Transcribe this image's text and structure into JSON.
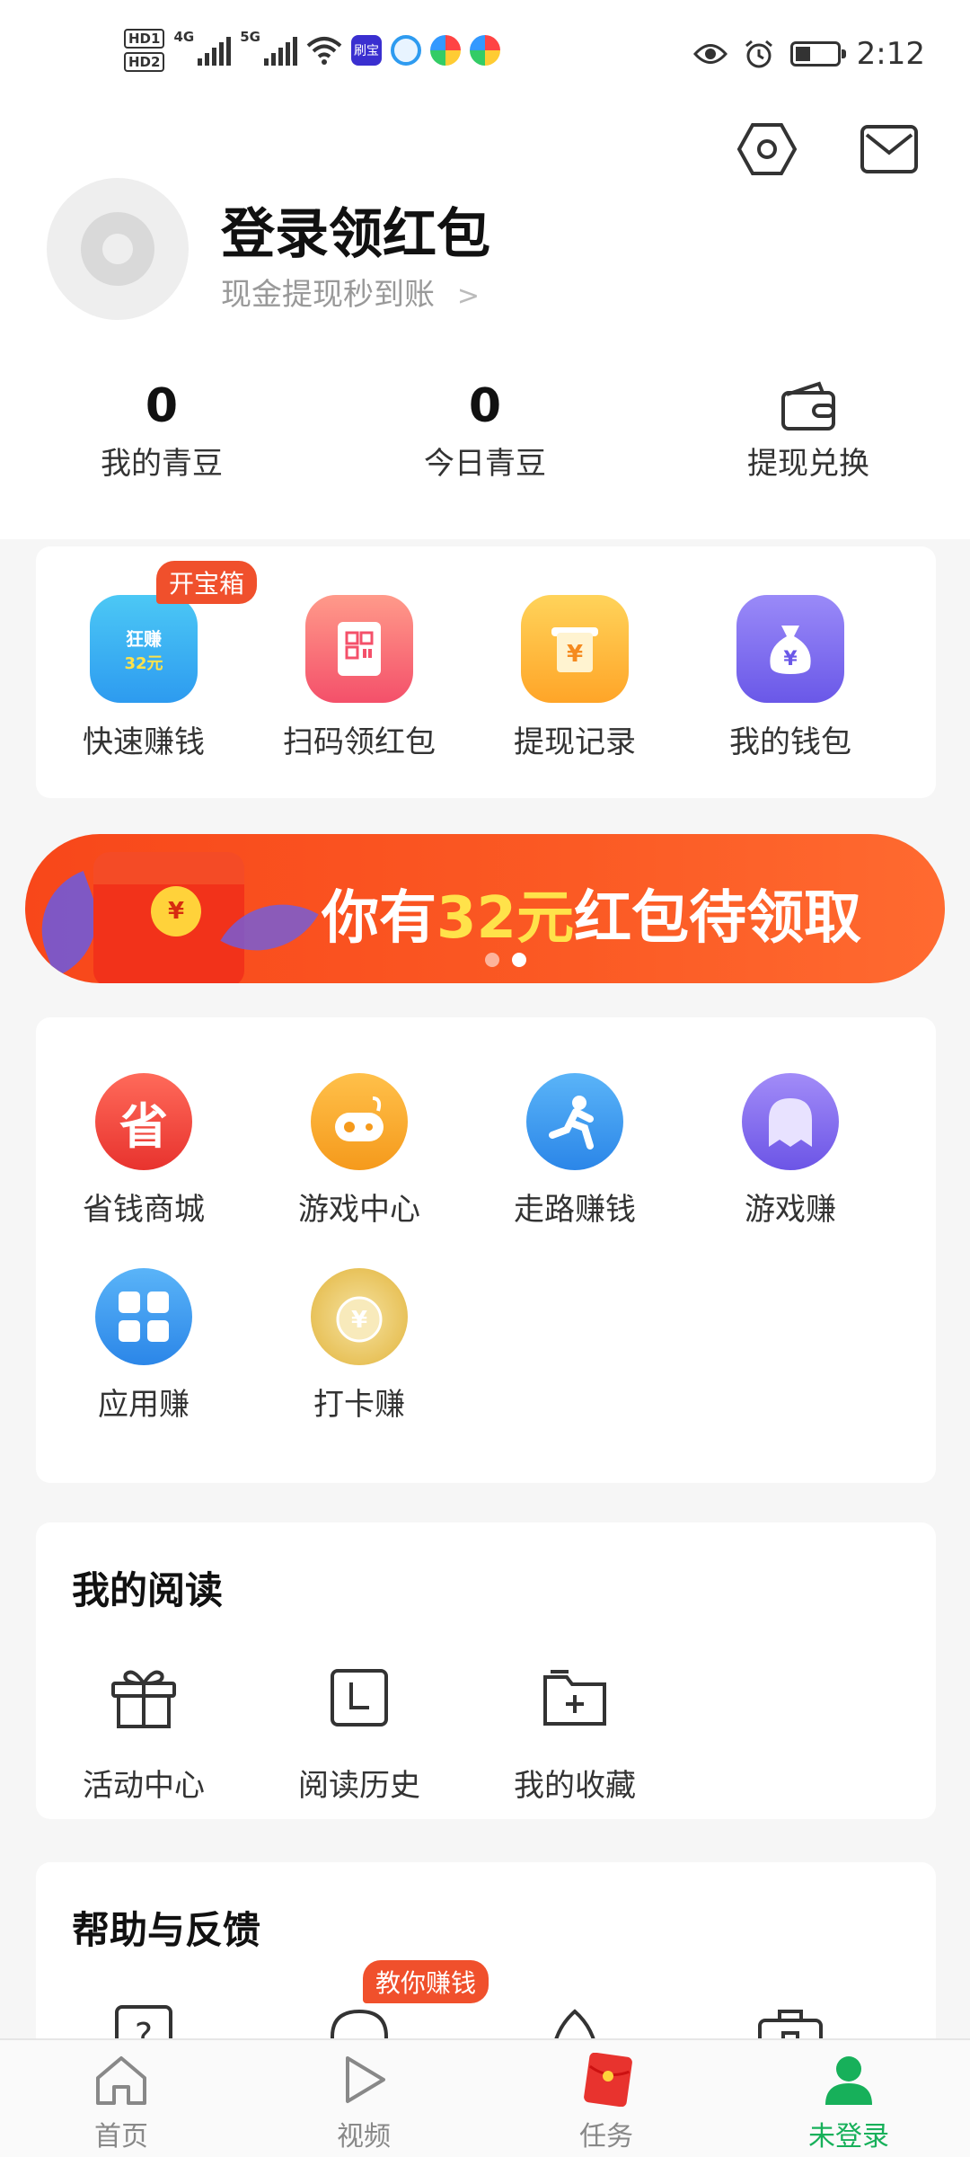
{
  "status_bar": {
    "hd1": "HD1",
    "hd2": "HD2",
    "net1": "4G",
    "net2": "5G",
    "app_label": "刷宝",
    "time": "2:12"
  },
  "header": {
    "login_title": "登录领红包",
    "login_subtitle": "现金提现秒到账",
    "stats": [
      {
        "value": "0",
        "label": "我的青豆"
      },
      {
        "value": "0",
        "label": "今日青豆"
      },
      {
        "label": "提现兑换"
      }
    ]
  },
  "quick_actions": {
    "badge": "开宝箱",
    "items": [
      {
        "label": "快速赚钱",
        "icon": "treasure-box-icon",
        "icon_text_1": "狂赚",
        "icon_text_2": "32元"
      },
      {
        "label": "扫码领红包",
        "icon": "qr-envelope-icon"
      },
      {
        "label": "提现记录",
        "icon": "withdraw-record-icon"
      },
      {
        "label": "我的钱包",
        "icon": "money-bag-icon"
      }
    ]
  },
  "banner": {
    "prefix": "你有",
    "highlight": "32元",
    "suffix": "红包待领取",
    "active_page": 2,
    "total_pages": 2
  },
  "services": {
    "items": [
      {
        "label": "省钱商城",
        "icon": "save-money-icon",
        "icon_text": "省"
      },
      {
        "label": "游戏中心",
        "icon": "gamepad-icon"
      },
      {
        "label": "走路赚钱",
        "icon": "running-icon"
      },
      {
        "label": "游戏赚",
        "icon": "ghost-icon"
      },
      {
        "label": "应用赚",
        "icon": "apps-grid-icon"
      },
      {
        "label": "打卡赚",
        "icon": "checkin-coin-icon"
      }
    ]
  },
  "reading": {
    "title": "我的阅读",
    "items": [
      {
        "label": "活动中心",
        "icon": "gift-icon"
      },
      {
        "label": "阅读历史",
        "icon": "history-clock-icon"
      },
      {
        "label": "我的收藏",
        "icon": "favorites-folder-icon"
      }
    ]
  },
  "help": {
    "title": "帮助与反馈",
    "badge": "教你赚钱",
    "icons": [
      "question-icon",
      "headset-icon",
      "customer-service-icon",
      "briefcase-icon"
    ]
  },
  "bottom_nav": {
    "items": [
      {
        "label": "首页",
        "icon": "home-icon"
      },
      {
        "label": "视频",
        "icon": "play-icon"
      },
      {
        "label": "任务",
        "icon": "red-envelope-icon"
      },
      {
        "label": "未登录",
        "icon": "user-icon"
      }
    ],
    "active_index": 3
  },
  "colors": {
    "accent_green": "#17b05a",
    "badge_red": "#f0502c",
    "banner_orange": "#fb5a24",
    "highlight_yellow": "#ffe24a"
  }
}
